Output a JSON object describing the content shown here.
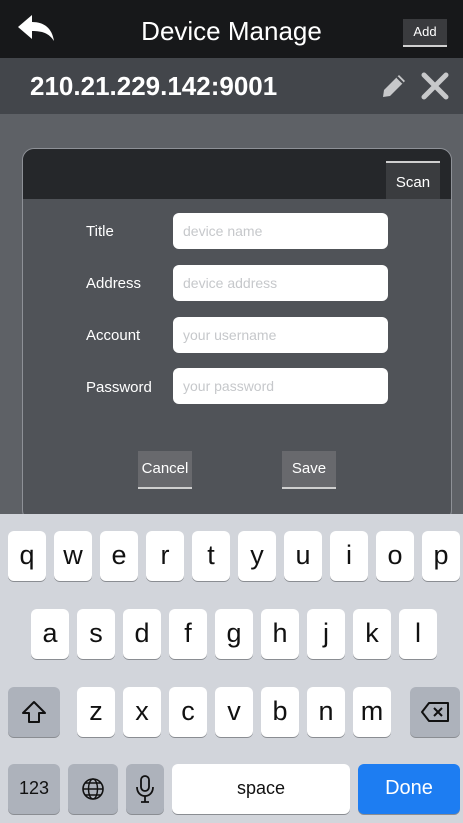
{
  "header": {
    "title": "Device Manage",
    "add_label": "Add"
  },
  "device": {
    "address": "210.21.229.142:9001"
  },
  "dialog": {
    "scan_label": "Scan",
    "fields": [
      {
        "label": "Title",
        "placeholder": "device name"
      },
      {
        "label": "Address",
        "placeholder": "device address"
      },
      {
        "label": "Account",
        "placeholder": "your username"
      },
      {
        "label": "Password",
        "placeholder": "your password"
      }
    ],
    "cancel_label": "Cancel",
    "save_label": "Save"
  },
  "keyboard": {
    "row1": [
      "q",
      "w",
      "e",
      "r",
      "t",
      "y",
      "u",
      "i",
      "o",
      "p"
    ],
    "row2": [
      "a",
      "s",
      "d",
      "f",
      "g",
      "h",
      "j",
      "k",
      "l"
    ],
    "row3": [
      "z",
      "x",
      "c",
      "v",
      "b",
      "n",
      "m"
    ],
    "numbers_label": "123",
    "space_label": "space",
    "done_label": "Done",
    "accent_color": "#1d7df2"
  }
}
